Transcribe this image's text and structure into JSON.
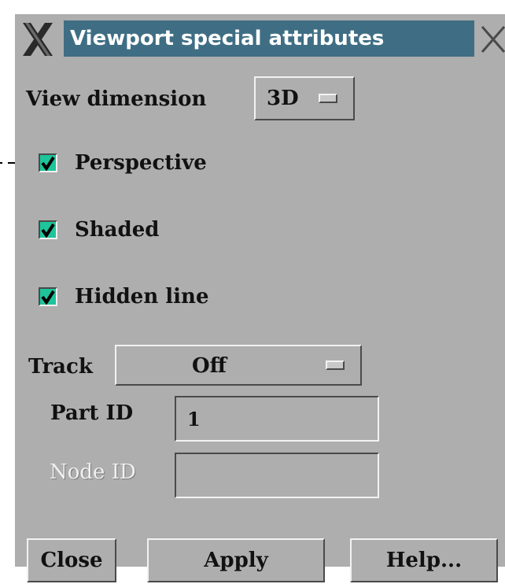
{
  "window": {
    "title": "Viewport special attributes"
  },
  "view_dimension": {
    "label": "View dimension",
    "value": "3D"
  },
  "checkboxes": [
    {
      "label": "Perspective",
      "checked": true
    },
    {
      "label": "Shaded",
      "checked": true
    },
    {
      "label": "Hidden line",
      "checked": true
    }
  ],
  "track": {
    "label": "Track",
    "value": "Off"
  },
  "part_id": {
    "label": "Part ID",
    "value": "1"
  },
  "node_id": {
    "label": "Node ID",
    "value": ""
  },
  "buttons": {
    "close": "Close",
    "apply": "Apply",
    "help": "Help..."
  },
  "colors": {
    "title_bar": "#3f6e84",
    "panel": "#aeaeae",
    "checkbox_fill": "#1ec49a"
  }
}
